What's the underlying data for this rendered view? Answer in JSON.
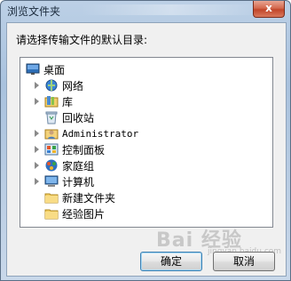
{
  "window": {
    "title": "浏览文件夹",
    "close_label": "x"
  },
  "dialog": {
    "prompt": "请选择传输文件的默认目录:",
    "tree": [
      {
        "label": "桌面",
        "icon": "desktop-icon",
        "expandable": false,
        "mono": false
      },
      {
        "label": "网络",
        "icon": "network-icon",
        "expandable": true,
        "mono": false
      },
      {
        "label": "库",
        "icon": "library-icon",
        "expandable": true,
        "mono": false
      },
      {
        "label": "回收站",
        "icon": "recycle-bin-icon",
        "expandable": false,
        "mono": false
      },
      {
        "label": "Administrator",
        "icon": "user-folder-icon",
        "expandable": true,
        "mono": true
      },
      {
        "label": "控制面板",
        "icon": "control-panel-icon",
        "expandable": true,
        "mono": false
      },
      {
        "label": "家庭组",
        "icon": "homegroup-icon",
        "expandable": true,
        "mono": false
      },
      {
        "label": "计算机",
        "icon": "computer-icon",
        "expandable": true,
        "mono": false
      },
      {
        "label": "新建文件夹",
        "icon": "folder-icon",
        "expandable": false,
        "mono": false
      },
      {
        "label": "经验图片",
        "icon": "folder-icon",
        "expandable": false,
        "mono": false
      }
    ],
    "ok_label": "确定",
    "cancel_label": "取消"
  },
  "watermark": {
    "text": "Bai 经验",
    "sub": "jingyan.baidu.com"
  }
}
